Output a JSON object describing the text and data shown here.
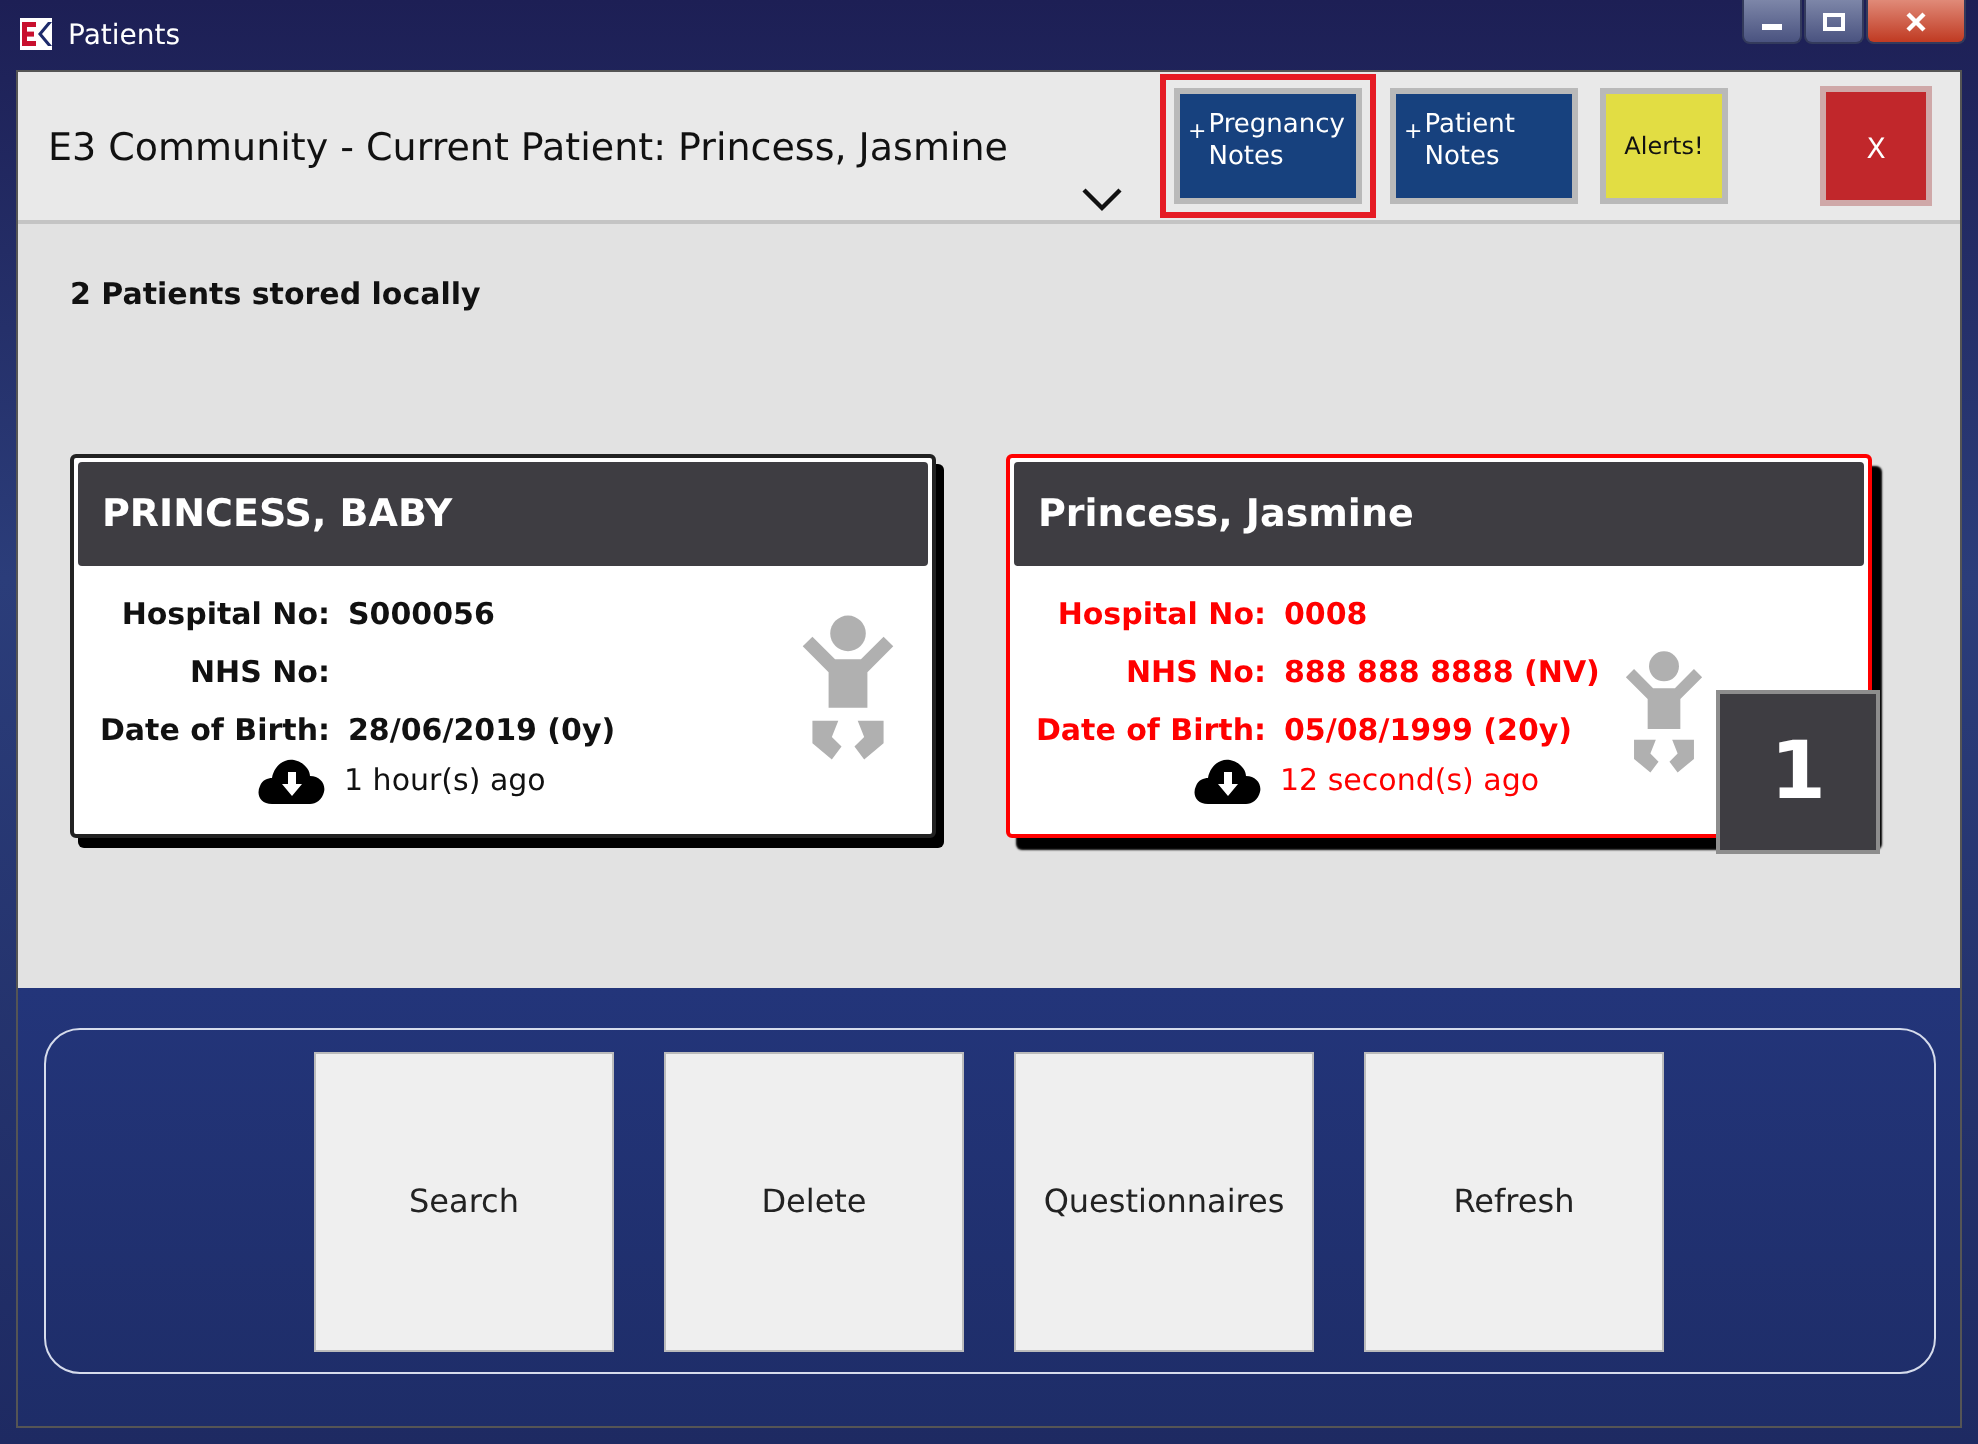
{
  "window": {
    "title": "Patients"
  },
  "header": {
    "title": "E3 Community - Current Patient: Princess, Jasmine",
    "buttons": [
      {
        "kind": "note",
        "prefix": "+",
        "label": "Pregnancy Notes",
        "highlighted": true
      },
      {
        "kind": "note",
        "prefix": "+",
        "label": "Patient Notes",
        "highlighted": false
      },
      {
        "kind": "alert",
        "label": "Alerts!",
        "highlighted": false
      },
      {
        "kind": "close",
        "label": "X",
        "highlighted": false
      }
    ]
  },
  "summary": "2 Patients stored locally",
  "patients": [
    {
      "name": "PRINCESS, BABY",
      "selected": false,
      "fields": [
        {
          "label": "Hospital No:",
          "value": "S000056"
        },
        {
          "label": "NHS No:"
        },
        {
          "label": "Date of Birth:",
          "value": "28/06/2019 (0y)"
        }
      ],
      "synced": "1 hour(s) ago"
    },
    {
      "name": "Princess, Jasmine",
      "selected": true,
      "fields": [
        {
          "label": "Hospital No:",
          "value": "0008"
        },
        {
          "label": "NHS No:",
          "value": "888 888 8888 (NV)"
        },
        {
          "label": "Date of Birth:",
          "value": "05/08/1999 (20y)"
        }
      ],
      "synced": "12 second(s) ago",
      "badge": "1"
    }
  ],
  "actions": [
    "Search",
    "Delete",
    "Questionnaires",
    "Refresh"
  ]
}
